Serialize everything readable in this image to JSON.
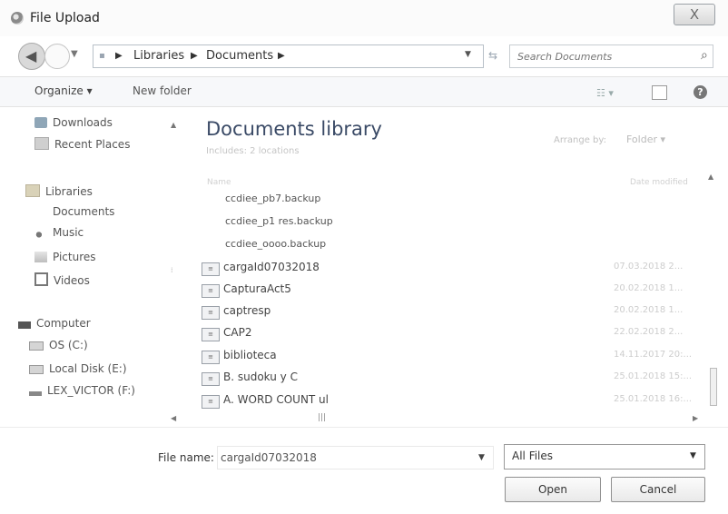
{
  "window": {
    "title": "File Upload",
    "close_label": "X"
  },
  "nav": {
    "path": [
      "Libraries",
      "Documents"
    ],
    "search_placeholder": "Search Documents"
  },
  "toolbar": {
    "organize_label": "Organize ▾",
    "new_folder_label": "New folder"
  },
  "nav_pane": {
    "items": [
      {
        "label": "Downloads",
        "icon": "downloads-icon"
      },
      {
        "label": "Recent Places",
        "icon": "recent-places-icon"
      },
      {
        "label": "Libraries",
        "icon": "libraries-icon"
      },
      {
        "label": "Documents",
        "icon": "documents-icon"
      },
      {
        "label": "Music",
        "icon": "music-icon"
      },
      {
        "label": "Pictures",
        "icon": "pictures-icon"
      },
      {
        "label": "Videos",
        "icon": "videos-icon"
      },
      {
        "label": "Computer",
        "icon": "computer-icon"
      },
      {
        "label": "OS (C:)",
        "icon": "drive-icon"
      },
      {
        "label": "Local Disk (E:)",
        "icon": "drive-icon"
      },
      {
        "label": "LEX_VICTOR (F:)",
        "icon": "usb-drive-icon"
      }
    ]
  },
  "library": {
    "title": "Documents library",
    "subtitle": "Includes: 2 locations",
    "arrange_by_label": "Arrange by:",
    "arrange_by_value": "Folder ▾",
    "columns": {
      "name": "Name",
      "date": "Date modified"
    }
  },
  "files": [
    {
      "name": "ccdiee_pb7.backup",
      "date": "",
      "type": "plain"
    },
    {
      "name": "ccdiee_p1 res.backup",
      "date": "",
      "type": "plain"
    },
    {
      "name": "ccdiee_oooo.backup",
      "date": "",
      "type": "plain"
    },
    {
      "name": "cargaId07032018",
      "date": "07.03.2018 2...",
      "type": "doc"
    },
    {
      "name": "CapturaAct5",
      "date": "20.02.2018 1...",
      "type": "doc"
    },
    {
      "name": "captresp",
      "date": "20.02.2018 1...",
      "type": "doc"
    },
    {
      "name": "CAP2",
      "date": "22.02.2018 2...",
      "type": "doc"
    },
    {
      "name": "biblioteca",
      "date": "14.11.2017 20:...",
      "type": "doc"
    },
    {
      "name": "B. sudoku y C",
      "date": "25.01.2018 15:...",
      "type": "doc"
    },
    {
      "name": "A. WORD COUNT ul",
      "date": "25.01.2018 16:...",
      "type": "doc"
    }
  ],
  "bottom": {
    "file_name_label": "File name:",
    "file_name_value": "cargaId07032018",
    "file_type_value": "All Files",
    "open_label": "Open",
    "cancel_label": "Cancel"
  }
}
